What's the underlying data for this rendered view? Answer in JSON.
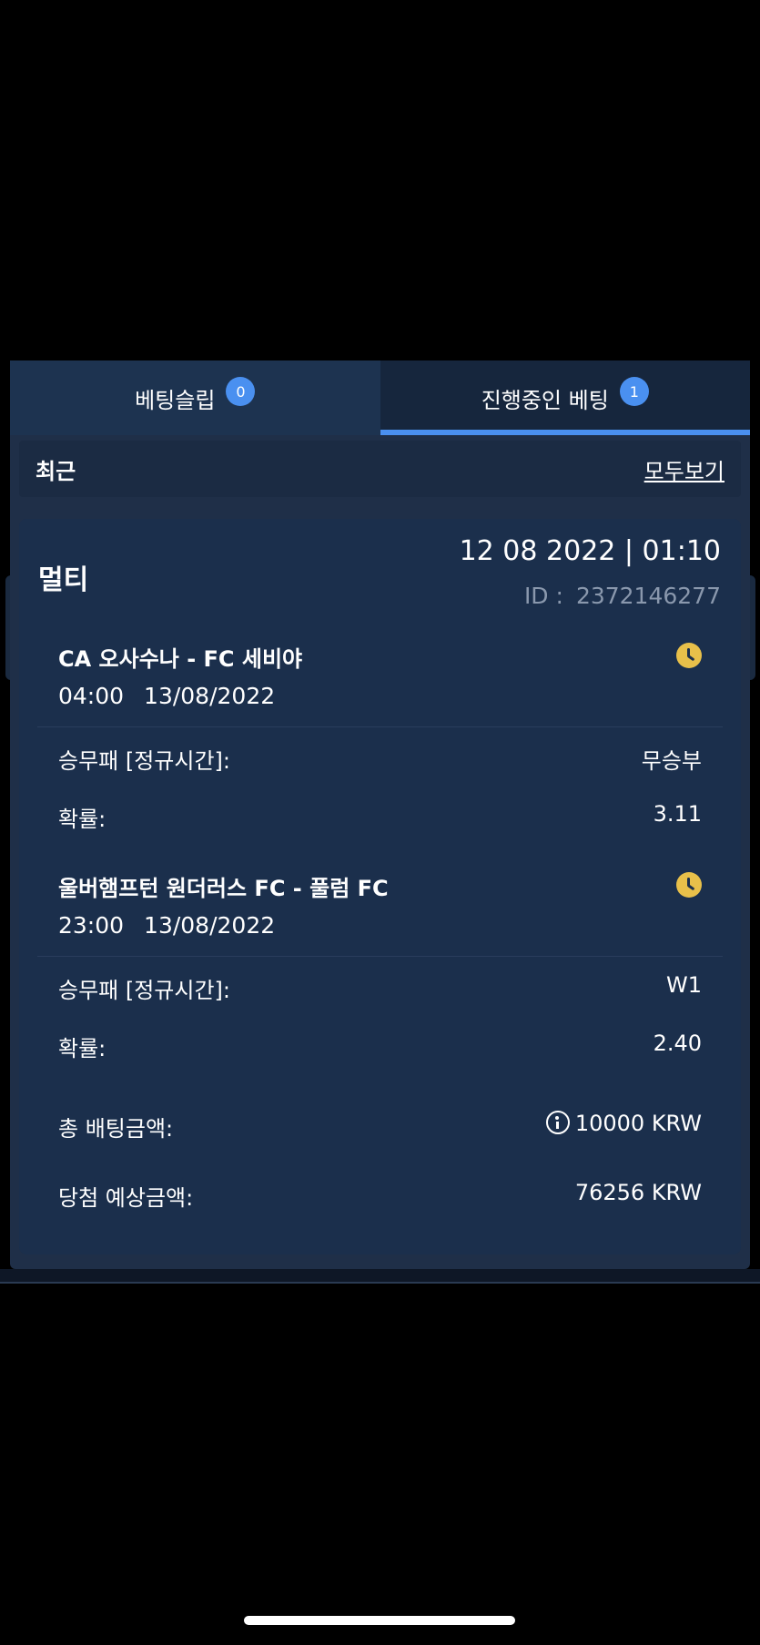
{
  "tabs": [
    {
      "label": "베팅슬립",
      "badge": "0"
    },
    {
      "label": "진행중인 베팅",
      "badge": "1"
    }
  ],
  "recent": {
    "title": "최근",
    "see_all": "모두보기"
  },
  "bet": {
    "type": "멀티",
    "date": "12 08 2022 | 01:10",
    "id_label": "ID :",
    "id_value": "2372146277",
    "matches": [
      {
        "name": "CA 오사수나 - FC 세비야",
        "time": "04:00",
        "date": "13/08/2022",
        "market_label": "승무패 [정규시간]:",
        "market_value": "무승부",
        "odds_label": "확률:",
        "odds_value": "3.11"
      },
      {
        "name": "울버햄프턴 원더러스 FC - 풀럼 FC",
        "time": "23:00",
        "date": "13/08/2022",
        "market_label": "승무패 [정규시간]:",
        "market_value": "W1",
        "odds_label": "확률:",
        "odds_value": "2.40"
      }
    ],
    "total_label": "총 배팅금액:",
    "total_value": "10000 KRW",
    "payout_label": "당첨 예상금액:",
    "payout_value": "76256 KRW"
  },
  "colors": {
    "accent": "#4a90f0",
    "panel": "#1f2f48",
    "card": "#1b2f4c",
    "clock": "#e8c04a"
  },
  "icons": {
    "pending": "clock-icon",
    "info": "info-icon"
  }
}
